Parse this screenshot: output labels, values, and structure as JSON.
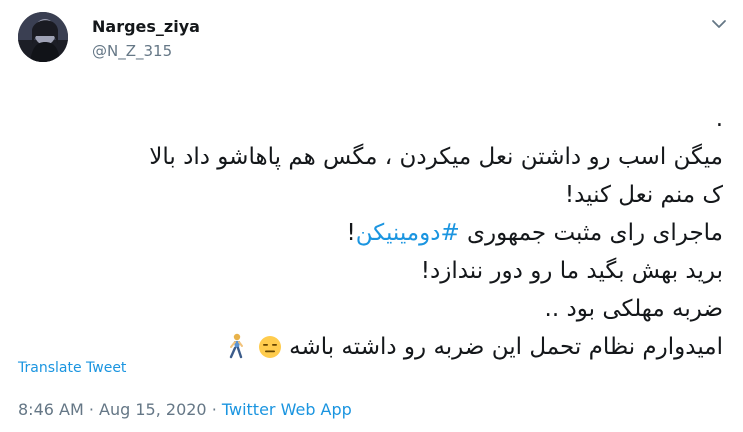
{
  "author": {
    "display_name": "Narges_ziya",
    "handle": "@N_Z_315"
  },
  "tweet": {
    "lines": [
      ".",
      "میگن اسب رو داشتن نعل میکردن ، مگس هم پاهاشو داد بالا",
      "ک منم نعل کنید!",
      "ضربه مهلکی بود ..",
      "امیدوارم نظام تحمل این ضربه رو داشته باشه",
      "برید بهش بگید ما رو دور نندازد!"
    ],
    "hashtag_line_prefix": "ماجرای رای مثبت جمهوری ",
    "hashtag": "#دومینیکن",
    "hashtag_line_suffix": "!",
    "emojis": [
      "expressionless-face",
      "person-walking"
    ]
  },
  "translate_label": "Translate Tweet",
  "meta": {
    "time": "8:46 AM",
    "separator": " · ",
    "date": "Aug 15, 2020",
    "source": "Twitter Web App"
  },
  "colors": {
    "link": "#1b95e0",
    "secondary": "#657786",
    "text": "#14171a"
  },
  "icons": {
    "caret": "chevron-down-icon"
  }
}
